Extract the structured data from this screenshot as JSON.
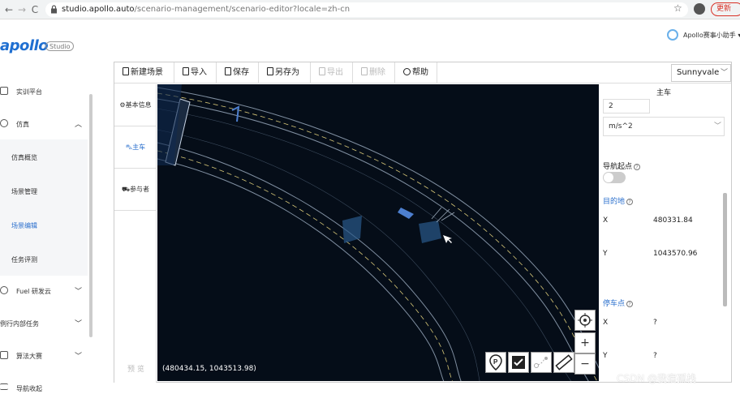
{
  "browser": {
    "back": "←",
    "forward": "→",
    "reload": "C",
    "url_host": "studio.apollo.auto",
    "url_path": "/scenario-management/scenario-editor?locale=zh-cn",
    "update_label": "更新"
  },
  "sidebar": {
    "logo": "apollo",
    "logo_badge": "Studio",
    "items": [
      {
        "label": "实训平台"
      },
      {
        "label": "仿真"
      },
      {
        "label": "仿真概览"
      },
      {
        "label": "场景管理"
      },
      {
        "label": "场景编辑"
      },
      {
        "label": "任务评测"
      },
      {
        "label": "Fuel 研发云"
      },
      {
        "label": "例行内部任务"
      },
      {
        "label": "算法大赛"
      },
      {
        "label": "导航收起"
      }
    ]
  },
  "user": {
    "name": "Apollo赛事小助手"
  },
  "toolbar": {
    "new_scene": "新建场景",
    "import": "导入",
    "save": "保存",
    "save_as": "另存为",
    "export": "导出",
    "delete": "删除",
    "help": "帮助",
    "region": "Sunnyvale"
  },
  "tabs": {
    "basic_info": "基本信息",
    "main_car": "主车",
    "participants": "参与者",
    "preview": "预 览"
  },
  "map": {
    "coordinates": "(480434.15, 1043513.98)"
  },
  "panel": {
    "title": "主车",
    "accel_value": "2",
    "accel_unit": "m/s^2",
    "nav_start_label": "导航起点",
    "destination_label": "目的地",
    "dest_x_key": "X",
    "dest_x_val": "480331.84",
    "dest_y_key": "Y",
    "dest_y_val": "1043570.96",
    "parking_label": "停车点",
    "park_x_key": "X",
    "park_x_val": "?",
    "park_y_key": "Y",
    "park_y_val": "?"
  },
  "watermark": "CSDN @我宿孤栈",
  "colors": {
    "accent": "#2a6fcd",
    "map_bg": "#050d18",
    "road_line": "#d8c878"
  }
}
